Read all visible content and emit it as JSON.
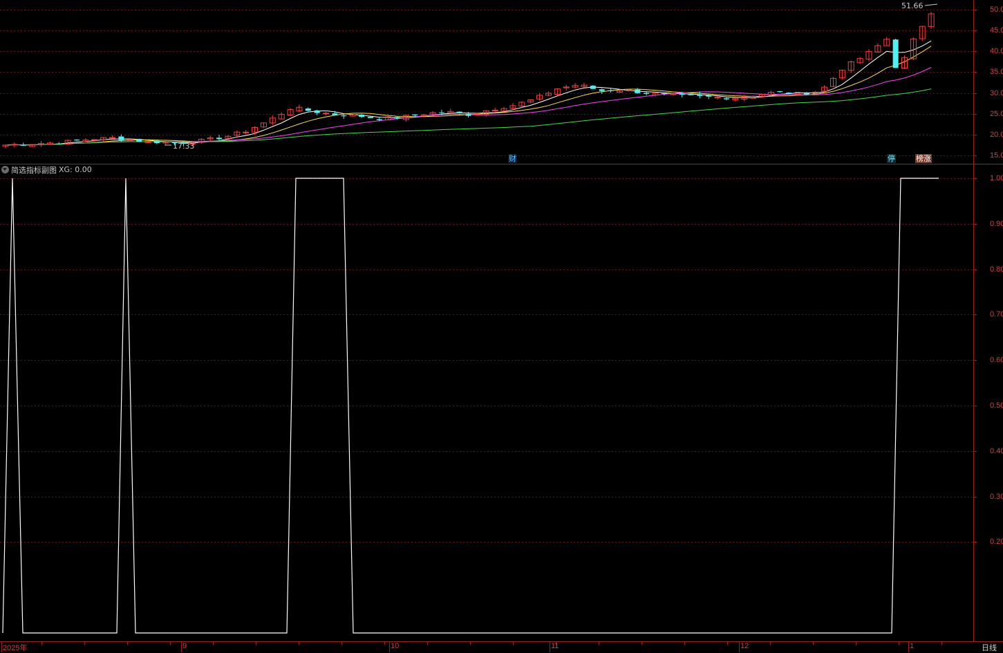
{
  "app": {
    "indicator_title": "简选指标副图",
    "indicator_value_label": "XG: 0.00",
    "period_label": "日线"
  },
  "price_panel": {
    "y_ticks": [
      "50.00",
      "45.00",
      "40.00",
      "35.00",
      "30.00",
      "25.00",
      "20.00",
      "15.00"
    ],
    "high_annotation": "51.66",
    "low_annotation": "17.33",
    "events": [
      {
        "label": "财",
        "color": "#5bc8ff",
        "bg": "#0a1a3a"
      },
      {
        "label": "停",
        "color": "#7fe8e8",
        "bg": "#0a2a3a"
      },
      {
        "label": "榜涨",
        "color": "#ffffff",
        "bg": "#7a3a2a"
      }
    ],
    "colors": {
      "up": "#ff3c3c",
      "down": "#54f0f0",
      "ma5": "#ffffff",
      "ma10": "#ffe040",
      "ma20": "#ff40ff",
      "ma60": "#40e040"
    }
  },
  "x_axis": {
    "labels": [
      "2025年",
      "9",
      "10",
      "11",
      "12",
      "1"
    ]
  },
  "indicator_panel": {
    "y_ticks": [
      "1.00",
      "0.90",
      "0.80",
      "0.70",
      "0.60",
      "0.50",
      "0.40",
      "0.30",
      "0.20"
    ],
    "line_color": "#ffffff"
  },
  "chart_data": [
    {
      "type": "line",
      "name": "price candlestick with moving averages",
      "ylim": [
        15,
        51.66
      ],
      "annotations": [
        "51.66",
        "17.33"
      ],
      "close_path": [
        17.5,
        17.8,
        18.0,
        18.4,
        19.0,
        19.2,
        18.5,
        18.2,
        18.0,
        18.6,
        19.5,
        21.0,
        23.5,
        26.5,
        25.5,
        24.8,
        24.5,
        23.8,
        24.2,
        25.0,
        25.5,
        24.8,
        26.0,
        27.0,
        28.5,
        31.0,
        32.0,
        30.5,
        30.8,
        30.0,
        29.5,
        29.2,
        29.0,
        28.8,
        29.5,
        30.2,
        29.8,
        30.5,
        36.0,
        39.0,
        43.0,
        47.0,
        49.0
      ]
    },
    {
      "type": "line",
      "name": "XG",
      "ylim": [
        0,
        1
      ],
      "series": [
        {
          "values": [
            0,
            1,
            1,
            0,
            0,
            0,
            0,
            0,
            0,
            0,
            0,
            1,
            1,
            0,
            0,
            0,
            0,
            0,
            0,
            0,
            0,
            0,
            0,
            0,
            0,
            0,
            0,
            0,
            1,
            1,
            1,
            1,
            1,
            1,
            0,
            0,
            0,
            0,
            0,
            0,
            0,
            0,
            0,
            0,
            0,
            0,
            0,
            0,
            0,
            0,
            0,
            0,
            0,
            0,
            0,
            0,
            0,
            0,
            0,
            0,
            0,
            0,
            0,
            0,
            0,
            0,
            0,
            0,
            0,
            0,
            0,
            0,
            0,
            0,
            0,
            0,
            0,
            0,
            0,
            0,
            0,
            0,
            0,
            0,
            0,
            0,
            1,
            1,
            1,
            1
          ]
        }
      ]
    }
  ]
}
